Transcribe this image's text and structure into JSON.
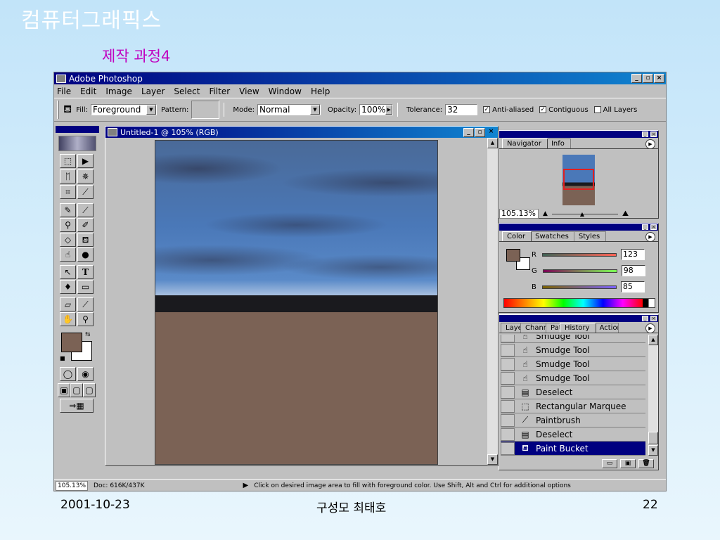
{
  "slide": {
    "title": "컴퓨터그래픽스",
    "subtitle": "제작 과정4",
    "footer_date": "2001-10-23",
    "footer_authors": "구성모 최태호",
    "page_number": "22",
    "title_color": "#ffffff",
    "subtitle_color": "#c000c0"
  },
  "window": {
    "title": "Adobe Photoshop",
    "buttons": {
      "minimize": "_",
      "maximize": "▫",
      "close": "×"
    }
  },
  "menu": [
    "File",
    "Edit",
    "Image",
    "Layer",
    "Select",
    "Filter",
    "View",
    "Window",
    "Help"
  ],
  "options": {
    "tool_icon": "paint-bucket-icon",
    "fill_label": "Fill:",
    "fill_value": "Foreground",
    "pattern_label": "Pattern:",
    "mode_label": "Mode:",
    "mode_value": "Normal",
    "opacity_label": "Opacity:",
    "opacity_value": "100%",
    "tolerance_label": "Tolerance:",
    "tolerance_value": "32",
    "anti_aliased_label": "Anti-aliased",
    "anti_aliased": true,
    "contiguous_label": "Contiguous",
    "contiguous": true,
    "all_layers_label": "All Layers",
    "all_layers": false
  },
  "document": {
    "title": "Untitled-1 @ 105% (RGB)",
    "foreground_color": "#7b6255",
    "background_color": "#ffffff",
    "sky_color": "#4a78b8",
    "ground_color": "#7b6255"
  },
  "navigator": {
    "tabs": [
      "Navigator",
      "Info"
    ],
    "zoom": "105.13%"
  },
  "color_palette": {
    "tabs": [
      "Color",
      "Swatches",
      "Styles"
    ],
    "r_label": "R",
    "r_value": "123",
    "g_label": "G",
    "g_value": "98",
    "b_label": "B",
    "b_value": "85"
  },
  "history": {
    "tabs": [
      "Layers",
      "Channels",
      "Paths",
      "History",
      "Actions"
    ],
    "items": [
      {
        "label": "Smudge Tool",
        "icon": "smudge-icon"
      },
      {
        "label": "Smudge Tool",
        "icon": "smudge-icon"
      },
      {
        "label": "Smudge Tool",
        "icon": "smudge-icon"
      },
      {
        "label": "Smudge Tool",
        "icon": "smudge-icon"
      },
      {
        "label": "Deselect",
        "icon": "deselect-icon"
      },
      {
        "label": "Rectangular Marquee",
        "icon": "marquee-icon"
      },
      {
        "label": "Paintbrush",
        "icon": "paintbrush-icon"
      },
      {
        "label": "Deselect",
        "icon": "deselect-icon"
      },
      {
        "label": "Paint Bucket",
        "icon": "paint-bucket-icon"
      }
    ],
    "selected_index": 8
  },
  "status": {
    "zoom": "105.13%",
    "doc_size": "Doc: 616K/437K",
    "hint": "Click on desired image area to fill with foreground color.  Use Shift, Alt and Ctrl for additional options"
  }
}
